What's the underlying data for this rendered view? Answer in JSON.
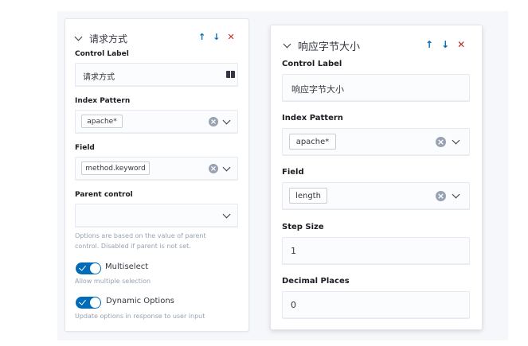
{
  "card1": {
    "title": "请求方式",
    "control_label": {
      "label": "Control Label",
      "value": "请求方式"
    },
    "index_pattern": {
      "label": "Index Pattern",
      "value": "apache*"
    },
    "field": {
      "label": "Field",
      "value": "method.keyword"
    },
    "parent_control": {
      "label": "Parent control",
      "value": "",
      "help_line1": "Options are based on the value of parent",
      "help_line2": "control. Disabled if parent is not set."
    },
    "multiselect": {
      "label": "Multiselect",
      "help": "Allow multiple selection",
      "on": true
    },
    "dynamic_options": {
      "label": "Dynamic Options",
      "help": "Update options in response to user input",
      "on": true
    }
  },
  "card2": {
    "title": "响应字节大小",
    "control_label": {
      "label": "Control Label",
      "value": "响应字节大小"
    },
    "index_pattern": {
      "label": "Index Pattern",
      "value": "apache*"
    },
    "field": {
      "label": "Field",
      "value": "length"
    },
    "step_size": {
      "label": "Step Size",
      "value": "1"
    },
    "decimal_places": {
      "label": "Decimal Places",
      "value": "0"
    }
  },
  "icons": {
    "move_up": "↑",
    "move_down": "↓",
    "remove": "✕",
    "clear": "×"
  },
  "colors": {
    "accent": "#006bb8",
    "danger": "#bd271e",
    "clear_badge": "#98a2b3"
  }
}
